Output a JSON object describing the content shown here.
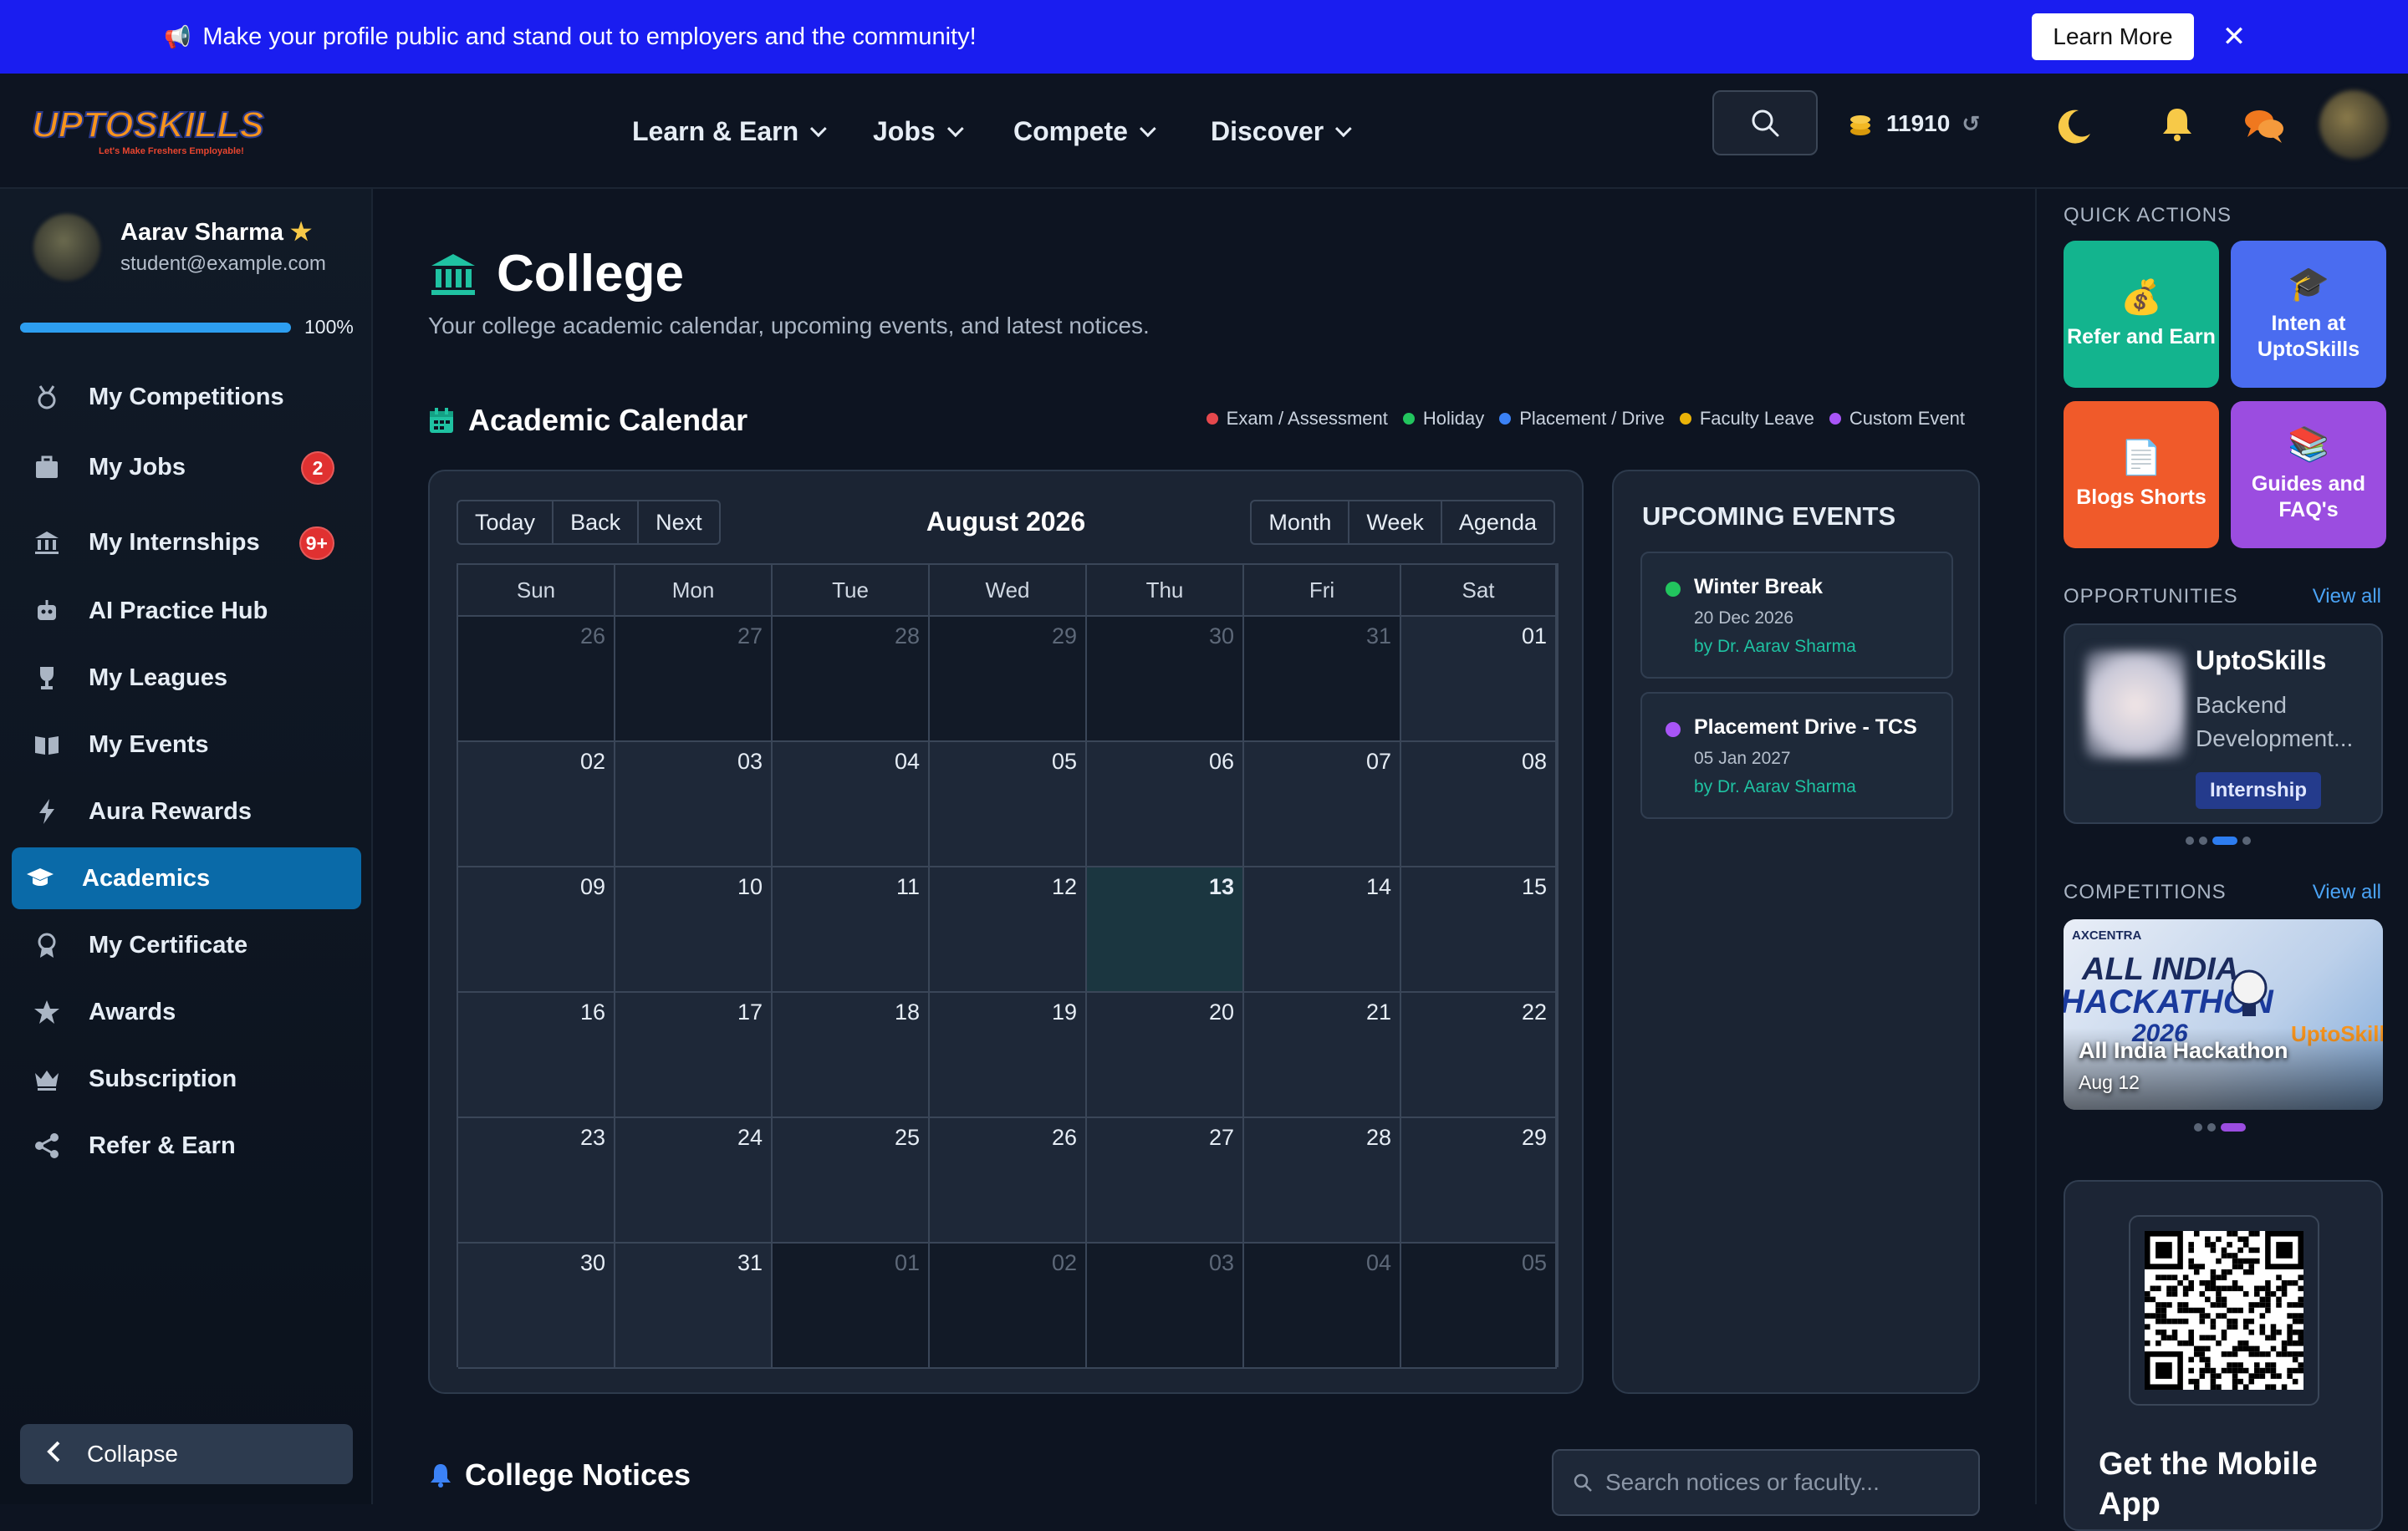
{
  "banner": {
    "message": "Make your profile public and stand out to employers and the community!",
    "learn_more": "Learn More"
  },
  "header": {
    "logo_text": "UPTOSKILLS",
    "logo_tagline": "Let's Make Freshers Employable!",
    "nav": [
      "Learn & Earn",
      "Jobs",
      "Compete",
      "Discover"
    ],
    "coins": "11910"
  },
  "sidebar": {
    "user_name": "Aarav Sharma",
    "user_email": "student@example.com",
    "profile_progress": 100,
    "progress_label": "100%",
    "items": [
      {
        "label": "My Competitions",
        "icon": "medal-icon"
      },
      {
        "label": "My Jobs",
        "icon": "briefcase-icon",
        "badge": "2"
      },
      {
        "label": "My Internships",
        "icon": "institution-icon",
        "badge": "9+"
      },
      {
        "label": "AI Practice Hub",
        "icon": "robot-icon"
      },
      {
        "label": "My Leagues",
        "icon": "trophy-icon"
      },
      {
        "label": "My Events",
        "icon": "book-icon"
      },
      {
        "label": "Aura Rewards",
        "icon": "bolt-icon"
      },
      {
        "label": "Academics",
        "icon": "graduation-cap-icon",
        "active": true
      },
      {
        "label": "My Certificate",
        "icon": "certificate-icon"
      },
      {
        "label": "Awards",
        "icon": "star-icon"
      },
      {
        "label": "Subscription",
        "icon": "crown-icon"
      },
      {
        "label": "Refer & Earn",
        "icon": "share-icon"
      }
    ],
    "collapse": "Collapse"
  },
  "main": {
    "title": "College",
    "subtitle": "Your college academic calendar, upcoming events, and latest notices.",
    "calendar_title": "Academic Calendar",
    "legend": [
      {
        "label": "Exam / Assessment",
        "color": "#e5484d"
      },
      {
        "label": "Holiday",
        "color": "#22c55e"
      },
      {
        "label": "Placement / Drive",
        "color": "#3b82f6"
      },
      {
        "label": "Faculty Leave",
        "color": "#eab308"
      },
      {
        "label": "Custom Event",
        "color": "#a855f7"
      }
    ],
    "toolbar_left": [
      "Today",
      "Back",
      "Next"
    ],
    "toolbar_right": [
      "Month",
      "Week",
      "Agenda"
    ],
    "month_label": "August 2026",
    "weekdays": [
      "Sun",
      "Mon",
      "Tue",
      "Wed",
      "Thu",
      "Fri",
      "Sat"
    ],
    "weeks": [
      [
        {
          "d": "26",
          "in": false
        },
        {
          "d": "27",
          "in": false
        },
        {
          "d": "28",
          "in": false
        },
        {
          "d": "29",
          "in": false
        },
        {
          "d": "30",
          "in": false
        },
        {
          "d": "31",
          "in": false
        },
        {
          "d": "01",
          "in": true
        }
      ],
      [
        {
          "d": "02",
          "in": true
        },
        {
          "d": "03",
          "in": true
        },
        {
          "d": "04",
          "in": true
        },
        {
          "d": "05",
          "in": true
        },
        {
          "d": "06",
          "in": true
        },
        {
          "d": "07",
          "in": true
        },
        {
          "d": "08",
          "in": true
        }
      ],
      [
        {
          "d": "09",
          "in": true
        },
        {
          "d": "10",
          "in": true
        },
        {
          "d": "11",
          "in": true
        },
        {
          "d": "12",
          "in": true
        },
        {
          "d": "13",
          "in": true,
          "today": true
        },
        {
          "d": "14",
          "in": true
        },
        {
          "d": "15",
          "in": true
        }
      ],
      [
        {
          "d": "16",
          "in": true
        },
        {
          "d": "17",
          "in": true
        },
        {
          "d": "18",
          "in": true
        },
        {
          "d": "19",
          "in": true
        },
        {
          "d": "20",
          "in": true
        },
        {
          "d": "21",
          "in": true
        },
        {
          "d": "22",
          "in": true
        }
      ],
      [
        {
          "d": "23",
          "in": true
        },
        {
          "d": "24",
          "in": true
        },
        {
          "d": "25",
          "in": true
        },
        {
          "d": "26",
          "in": true
        },
        {
          "d": "27",
          "in": true
        },
        {
          "d": "28",
          "in": true
        },
        {
          "d": "29",
          "in": true
        }
      ],
      [
        {
          "d": "30",
          "in": true
        },
        {
          "d": "31",
          "in": true
        },
        {
          "d": "01",
          "in": false
        },
        {
          "d": "02",
          "in": false
        },
        {
          "d": "03",
          "in": false
        },
        {
          "d": "04",
          "in": false
        },
        {
          "d": "05",
          "in": false
        }
      ]
    ],
    "upcoming_title": "UPCOMING EVENTS",
    "events": [
      {
        "title": "Winter Break",
        "date": "20 Dec 2026",
        "by": "by Dr. Aarav Sharma",
        "color": "#22c55e"
      },
      {
        "title": "Placement Drive - TCS",
        "date": "05 Jan 2027",
        "by": "by Dr. Aarav Sharma",
        "color": "#a855f7"
      }
    ],
    "notices_title": "College Notices",
    "notice_search_placeholder": "Search notices or faculty..."
  },
  "right": {
    "quick_actions_label": "QUICK ACTIONS",
    "quick_actions": [
      {
        "label": "Refer and Earn",
        "icon": "money-bag-icon",
        "color": "#13b48e"
      },
      {
        "label": "Inten at UptoSkills",
        "icon": "graduation-cap-icon",
        "color": "#4a6cf0"
      },
      {
        "label": "Blogs Shorts",
        "icon": "document-icon",
        "color": "#f05a2a"
      },
      {
        "label": "Guides and FAQ's",
        "icon": "books-icon",
        "color": "#9b4de0"
      }
    ],
    "opportunities_label": "OPPORTUNITIES",
    "view_all": "View all",
    "opportunity": {
      "company": "UptoSkills",
      "role": "Backend Development...",
      "tag": "Internship"
    },
    "competitions_label": "COMPETITIONS",
    "competition": {
      "name": "All India Hackathon",
      "date": "Aug 12",
      "banner_brand": "AXCENTRA",
      "banner_line1": "ALL INDIA",
      "banner_line2": "HACKATHON",
      "banner_year": "2026",
      "banner_logo": "UptoSkills"
    },
    "app_title": "Get the Mobile App"
  }
}
